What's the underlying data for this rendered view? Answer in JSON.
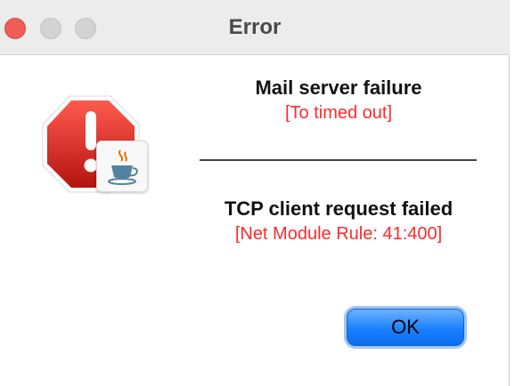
{
  "window": {
    "title": "Error"
  },
  "messages": [
    {
      "title": "Mail server failure",
      "detail": "[To timed out]"
    },
    {
      "title": "TCP client request failed",
      "detail": "[Net Module Rule: 41:400]"
    }
  ],
  "buttons": {
    "ok_label": "OK"
  },
  "icons": {
    "main": "stop-sign-exclamation-icon",
    "badge": "java-coffee-cup-icon"
  },
  "colors": {
    "detail_text": "#ff2a2a",
    "stop_sign": "#d2211c",
    "button_blue": "#1a80ff",
    "close_button": "#ee5e57"
  }
}
